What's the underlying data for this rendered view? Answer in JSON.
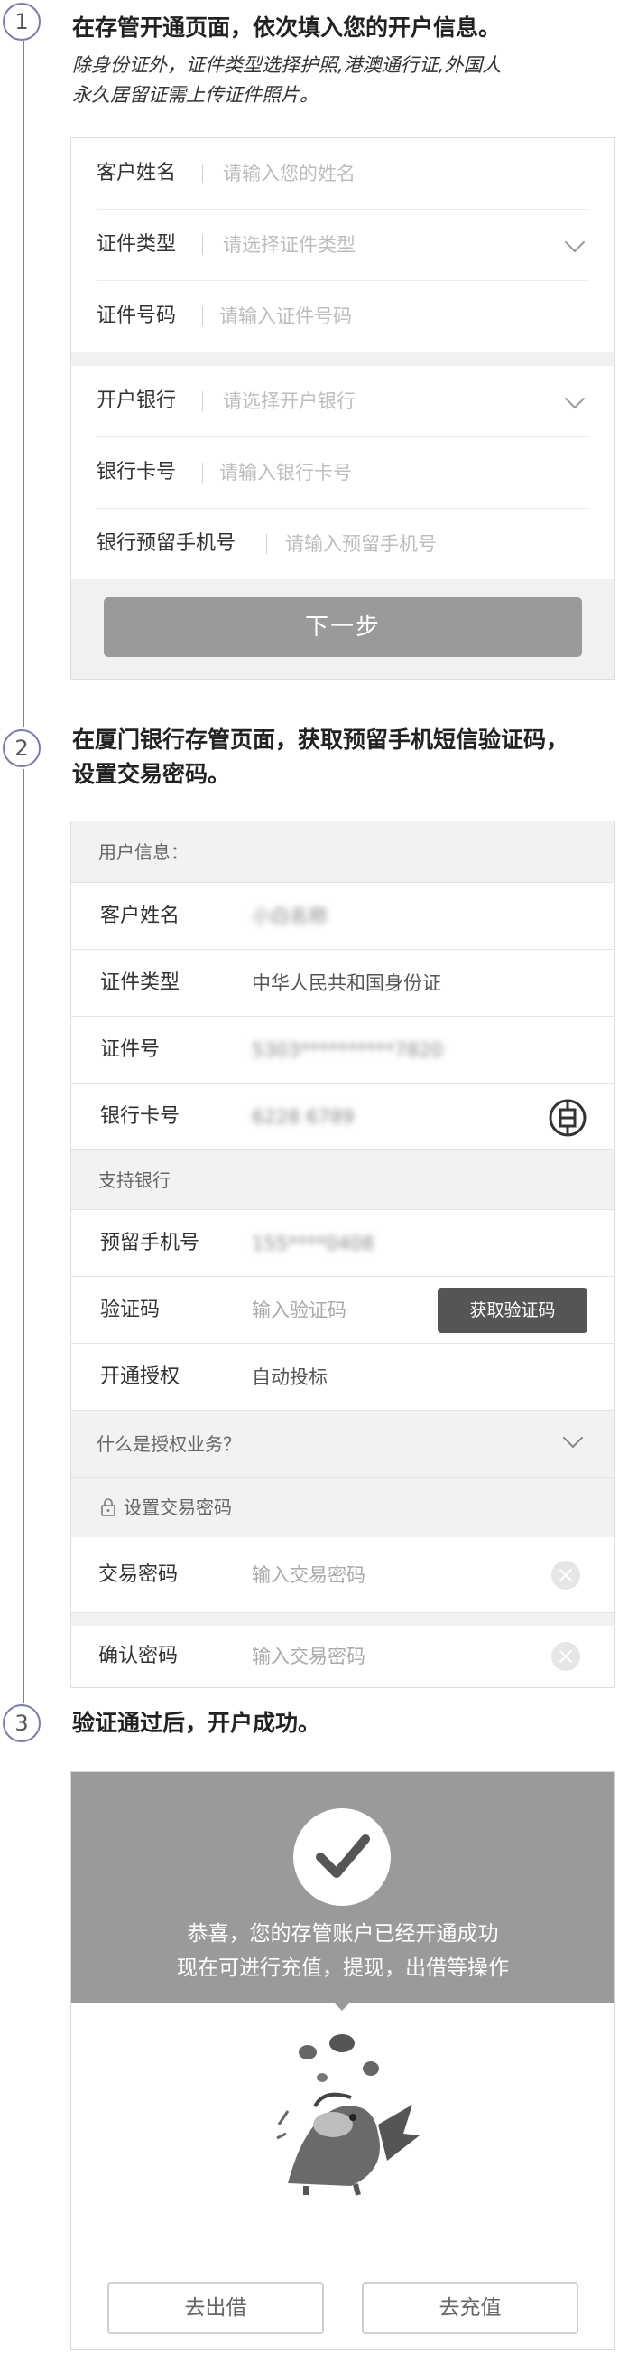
{
  "steps": [
    {
      "number": "1",
      "title": "在存管开通页面，依次填入您的开户信息。",
      "note_line1": "除身份证外，证件类型选择护照,港澳通行证,外国人",
      "note_line2": "永久居留证需上传证件照片。"
    },
    {
      "number": "2",
      "title_line1": "在厦门银行存管页面，获取预留手机短信验证码，",
      "title_line2": "设置交易密码。"
    },
    {
      "number": "3",
      "title": "验证通过后，开户成功。"
    }
  ],
  "form1": {
    "name_label": "客户姓名",
    "name_placeholder": "请输入您的姓名",
    "idtype_label": "证件类型",
    "idtype_placeholder": "请选择证件类型",
    "idno_label": "证件号码",
    "idno_placeholder": "请输入证件号码",
    "bank_label": "开户银行",
    "bank_placeholder": "请选择开户银行",
    "card_label": "银行卡号",
    "card_placeholder": "请输入银行卡号",
    "phone_label": "银行预留手机号",
    "phone_placeholder": "请输入预留手机号",
    "next_button": "下一步"
  },
  "form2": {
    "user_info_header": "用户信息：",
    "name_label": "客户姓名",
    "name_value": "小白名称",
    "idtype_label": "证件类型",
    "idtype_value": "中华人民共和国身份证",
    "idno_label": "证件号",
    "idno_value": "5303**********7820",
    "card_label": "银行卡号",
    "card_value": "6228 6789",
    "support_bank": "支持银行",
    "phone_label": "预留手机号",
    "phone_value": "155****0408",
    "code_label": "验证码",
    "code_placeholder": "输入验证码",
    "get_code_button": "获取验证码",
    "auth_label": "开通授权",
    "auth_value": "自动投标",
    "auth_question": "什么是授权业务？",
    "set_password_header": "设置交易密码",
    "password_label": "交易密码",
    "password_placeholder": "输入交易密码",
    "confirm_label": "确认密码",
    "confirm_placeholder": "输入交易密码"
  },
  "success": {
    "line1": "恭喜，您的存管账户已经开通成功",
    "line2": "现在可进行充值，提现，出借等操作",
    "lend_button": "去出借",
    "recharge_button": "去充值"
  },
  "icons": {
    "bank_logo": "icbc-bank-icon",
    "lock": "lock-icon",
    "check": "checkmark-icon",
    "mascot": "dragon-mascot-icon",
    "clear": "clear-input-icon",
    "dropdown": "chevron-down-icon"
  },
  "colors": {
    "timeline": "#7b7bb0",
    "button_grey": "#9a9a9a",
    "dark_button": "#555555"
  }
}
